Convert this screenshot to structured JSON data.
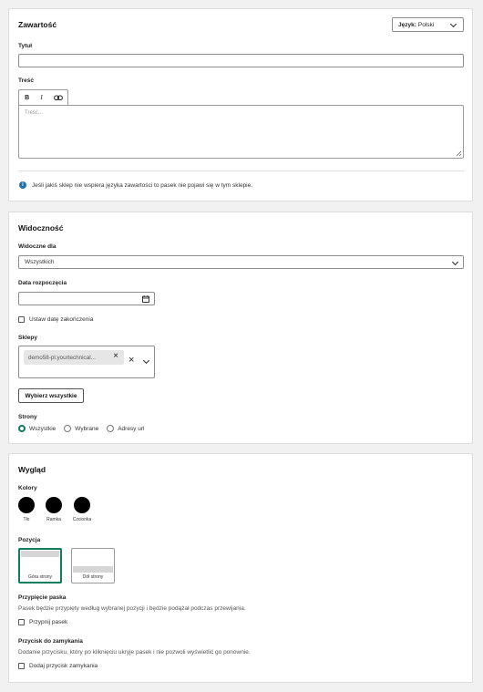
{
  "content": {
    "title": "Zawartość",
    "language": {
      "label": "Język:",
      "value": "Polski"
    },
    "title_field": {
      "label": "Tytuł",
      "value": ""
    },
    "body_field": {
      "label": "Treść",
      "placeholder": "Treść...",
      "toolbar": {
        "bold": "B",
        "italic": "I"
      }
    },
    "info": "Jeśli jakiś sklep nie wspiera języka zawartości to pasek nie pojawi się w tym sklepie."
  },
  "visibility": {
    "title": "Widoczność",
    "visible_for": {
      "label": "Widoczne dla",
      "value": "Wszystkich"
    },
    "start_date": {
      "label": "Data rozpoczęcia",
      "value": ""
    },
    "set_end_date": {
      "label": "Ustaw datę zakończenia",
      "checked": false
    },
    "shops": {
      "label": "Sklepy",
      "chip": "demo58-pl.yourtechnical..."
    },
    "select_all": "Wybierz wszystkie",
    "pages": {
      "label": "Strony",
      "options": [
        {
          "label": "Wszystkie",
          "selected": true
        },
        {
          "label": "Wybrane",
          "selected": false
        },
        {
          "label": "Adresy url",
          "selected": false
        }
      ]
    }
  },
  "appearance": {
    "title": "Wygląd",
    "colors": {
      "label": "Kolory",
      "items": [
        {
          "label": "Tło",
          "color": "#000000"
        },
        {
          "label": "Ramka",
          "color": "#000000"
        },
        {
          "label": "Czcionka",
          "color": "#000000"
        }
      ]
    },
    "position": {
      "label": "Pozycja",
      "options": [
        {
          "label": "Góra strony",
          "selected": true
        },
        {
          "label": "Dół strony",
          "selected": false
        }
      ]
    },
    "sticky": {
      "label": "Przypięcie paska",
      "description": "Pasek będzie przypięty według wybranej pozycji i będzie podążał podczas przewijania.",
      "checkbox": "Przypnij pasek",
      "checked": false
    },
    "close_button": {
      "label": "Przycisk do zamykania",
      "description": "Dodanie przycisku, który po kliknięciu ukryje pasek i nie pozwoli wyświetlić go ponownie.",
      "checkbox": "Dodaj przycisk zamykania",
      "checked": false
    },
    "accent": "#0e7e5c"
  }
}
